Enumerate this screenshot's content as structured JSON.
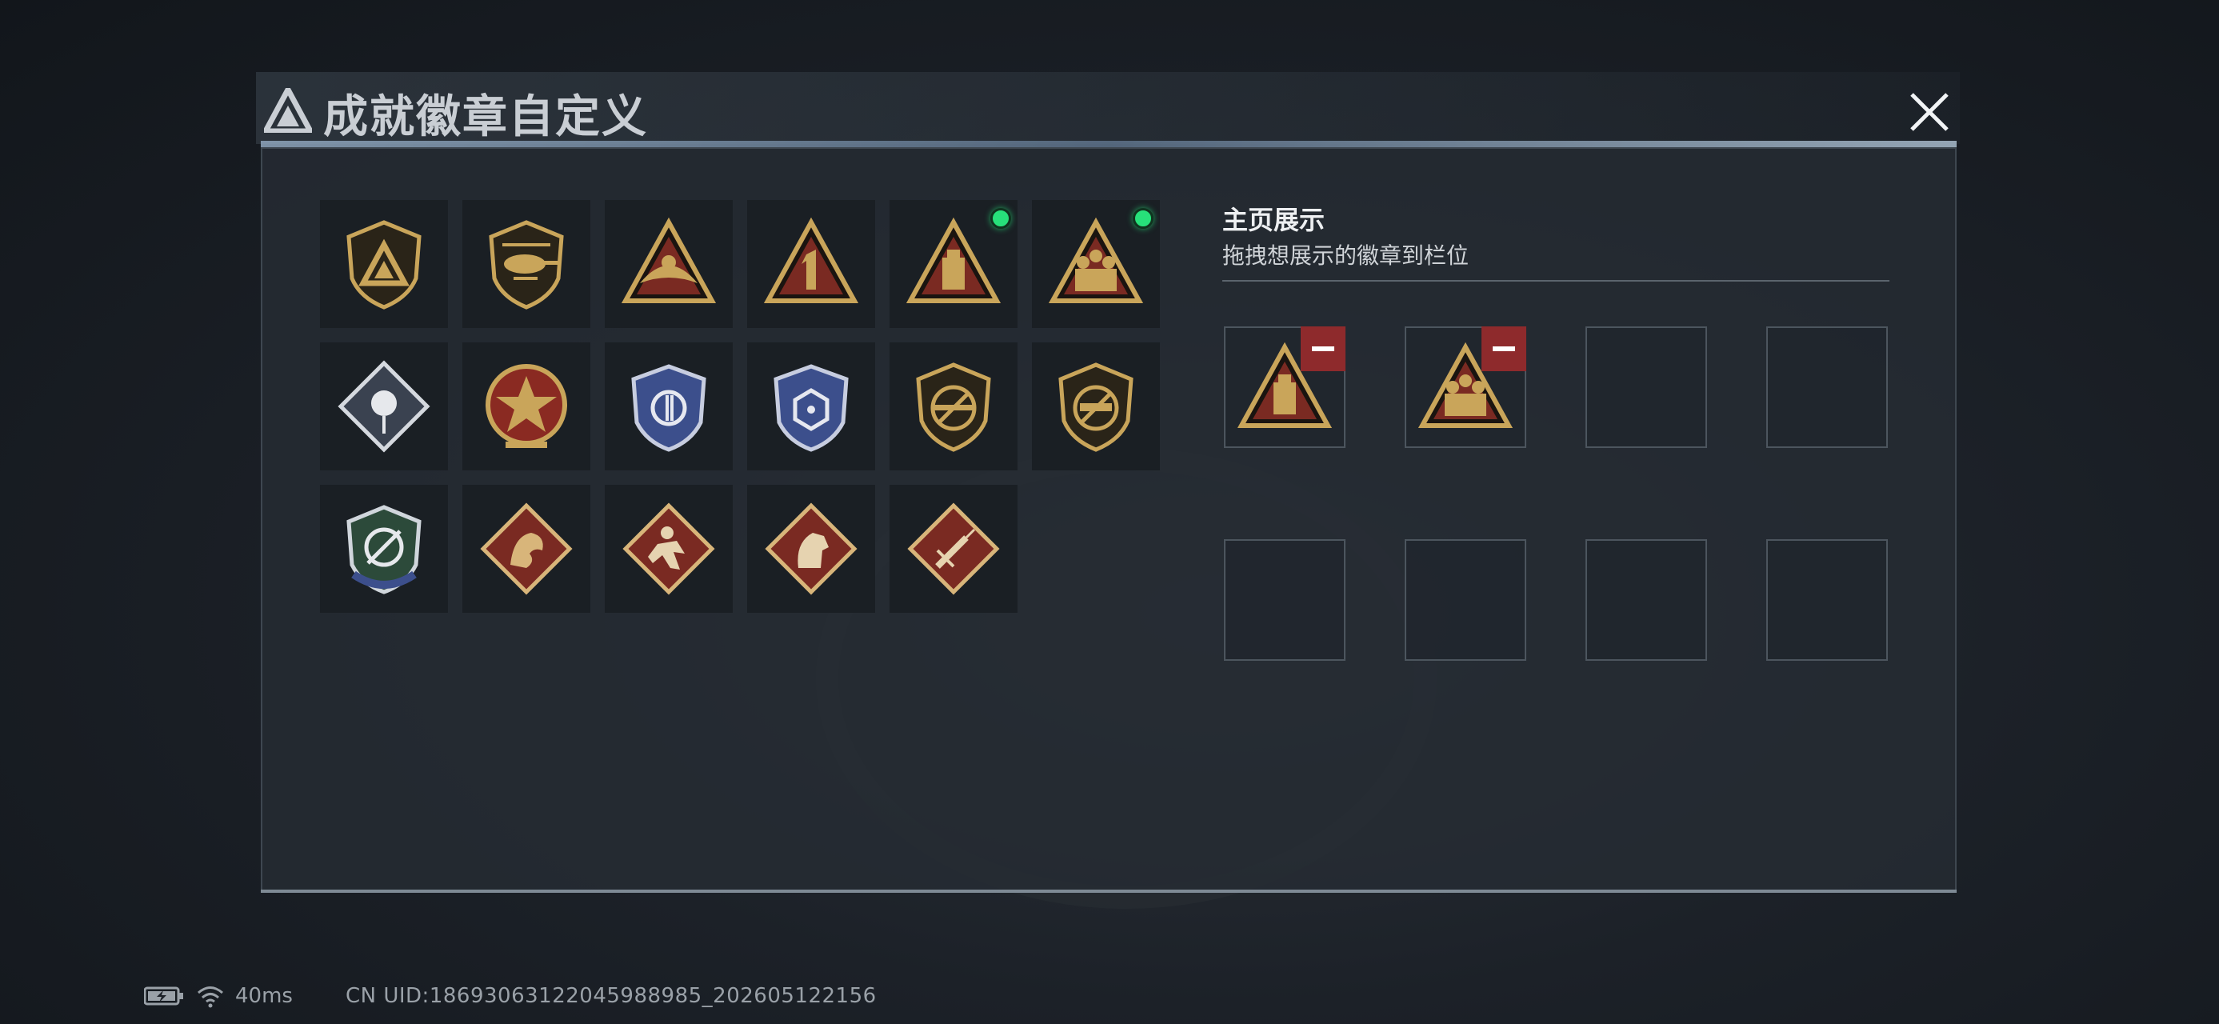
{
  "window": {
    "title": "成就徽章自定义"
  },
  "badges": [
    {
      "row": 1,
      "col": 1,
      "icon": "shield-logo-badge",
      "new": false
    },
    {
      "row": 1,
      "col": 2,
      "icon": "helicopter-badge",
      "new": false
    },
    {
      "row": 1,
      "col": 3,
      "icon": "eagle-triangle-badge",
      "new": false
    },
    {
      "row": 1,
      "col": 4,
      "icon": "number-one-triangle-badge",
      "new": false
    },
    {
      "row": 1,
      "col": 5,
      "icon": "usb-drive-triangle-badge",
      "new": true
    },
    {
      "row": 1,
      "col": 6,
      "icon": "squad-triangle-badge",
      "new": true
    },
    {
      "row": 2,
      "col": 1,
      "icon": "rose-diamond-badge",
      "new": false
    },
    {
      "row": 2,
      "col": 2,
      "icon": "star-medal-badge",
      "new": false
    },
    {
      "row": 2,
      "col": 3,
      "icon": "blue-wings-shield-badge",
      "new": false
    },
    {
      "row": 2,
      "col": 4,
      "icon": "blue-dice-shield-badge",
      "new": false
    },
    {
      "row": 2,
      "col": 5,
      "icon": "rifle-prohibited-shield-badge",
      "new": false
    },
    {
      "row": 2,
      "col": 6,
      "icon": "smg-prohibited-shield-badge",
      "new": false
    },
    {
      "row": 3,
      "col": 1,
      "icon": "crosshair-knife-shield-badge",
      "new": false
    },
    {
      "row": 3,
      "col": 2,
      "icon": "dragon-diamond-badge",
      "new": false
    },
    {
      "row": 3,
      "col": 3,
      "icon": "runner-diamond-badge",
      "new": false
    },
    {
      "row": 3,
      "col": 4,
      "icon": "horse-diamond-badge",
      "new": false
    },
    {
      "row": 3,
      "col": 5,
      "icon": "syringe-diamond-badge",
      "new": false
    }
  ],
  "showcase": {
    "title": "主页展示",
    "subtitle": "拖拽想展示的徽章到栏位",
    "slots": [
      {
        "icon": "usb-drive-triangle-badge"
      },
      {
        "icon": "squad-triangle-badge"
      },
      {
        "icon": null
      },
      {
        "icon": null
      },
      {
        "icon": null
      },
      {
        "icon": null
      },
      {
        "icon": null
      },
      {
        "icon": null
      }
    ]
  },
  "status": {
    "ping": "40ms",
    "uid": "CN UID:18693063122045988985_202605122156"
  },
  "colors": {
    "new_indicator": "#27e07a",
    "remove_button": "#8e2a2c",
    "badge_gold": "#c9a55a",
    "badge_red": "#7a2a22",
    "badge_blue": "#3c4f8c"
  }
}
